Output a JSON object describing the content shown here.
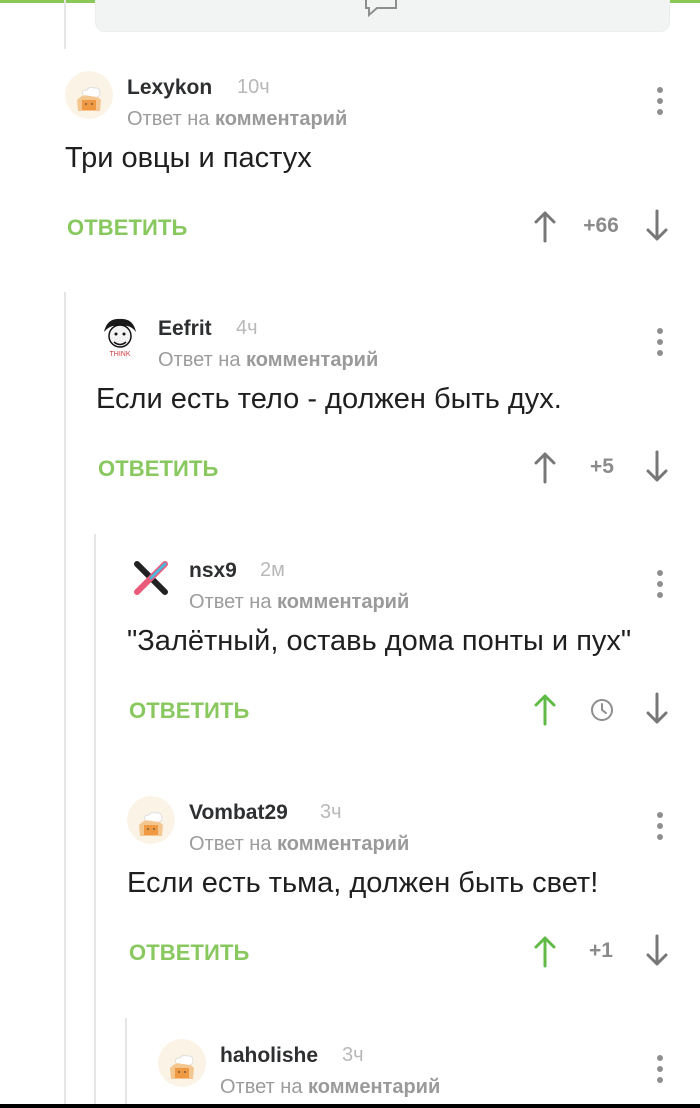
{
  "comments": [
    {
      "username": "Lexykon",
      "time": "10ч",
      "reply_prefix": "Ответ на",
      "reply_target": "комментарий",
      "text": "Три овцы и пастух",
      "reply_button": "ОТВЕТИТЬ",
      "score": "+66",
      "avatar_icon": "chef-hat-avatar-icon"
    },
    {
      "username": "Eefrit",
      "time": "4ч",
      "reply_prefix": "Ответ на",
      "reply_target": "комментарий",
      "text": "Если есть тело - должен быть дух.",
      "reply_button": "ОТВЕТИТЬ",
      "score": "+5",
      "avatar_icon": "think-einstein-avatar-icon"
    },
    {
      "username": "nsx9",
      "time": "2м",
      "reply_prefix": "Ответ на",
      "reply_target": "комментарий",
      "text": "\"Залётный, оставь дома понты и пух\"",
      "reply_button": "ОТВЕТИТЬ",
      "score": "",
      "avatar_icon": "x-logo-avatar-icon",
      "score_icon": "clock-icon"
    },
    {
      "username": "Vombat29",
      "time": "3ч",
      "reply_prefix": "Ответ на",
      "reply_target": "комментарий",
      "text": "Если есть тьма, должен быть свет!",
      "reply_button": "ОТВЕТИТЬ",
      "score": "+1",
      "avatar_icon": "chef-hat-avatar-icon"
    },
    {
      "username": "haholishe",
      "time": "3ч",
      "reply_prefix": "Ответ на",
      "reply_target": "комментарий",
      "text": "",
      "reply_button": "",
      "score": "",
      "avatar_icon": "chef-hat-avatar-icon"
    }
  ],
  "theme": {
    "accent": "#88c85f",
    "background": "#ffffff",
    "muted_text": "#9c9c9c",
    "icon": "#8f8f8f"
  }
}
